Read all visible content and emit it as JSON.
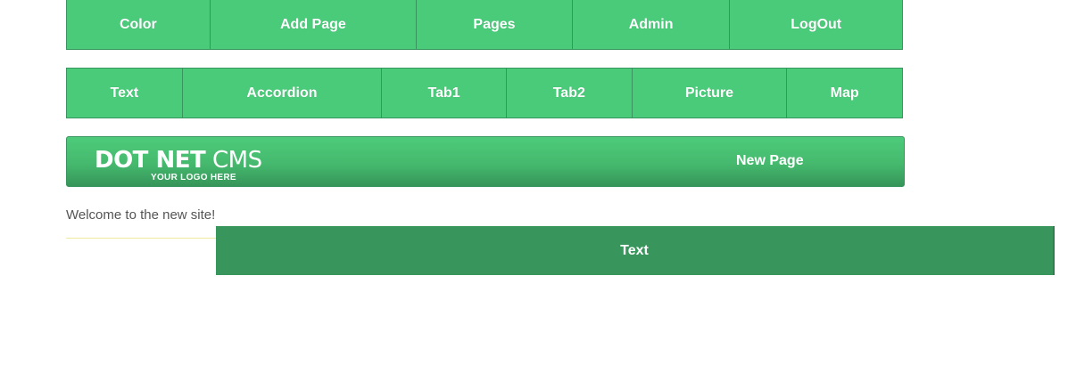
{
  "top_menu": {
    "items": [
      {
        "label": "Color"
      },
      {
        "label": "Add Page"
      },
      {
        "label": "Pages"
      },
      {
        "label": "Admin"
      },
      {
        "label": "LogOut"
      }
    ]
  },
  "page_menu": {
    "items": [
      {
        "label": "Text"
      },
      {
        "label": "Accordion"
      },
      {
        "label": "Tab1"
      },
      {
        "label": "Tab2"
      },
      {
        "label": "Picture"
      },
      {
        "label": "Map"
      }
    ]
  },
  "header": {
    "logo_bold": "DOT NET",
    "logo_light": "CMS",
    "logo_tagline": "YOUR LOGO HERE",
    "nav_link": "New Page"
  },
  "content": {
    "welcome": "Welcome to the new site!",
    "active_panel_label": "Text"
  },
  "colors": {
    "menu_green": "#4acb7a",
    "panel_green": "#38965c",
    "border_green": "#38955d"
  }
}
